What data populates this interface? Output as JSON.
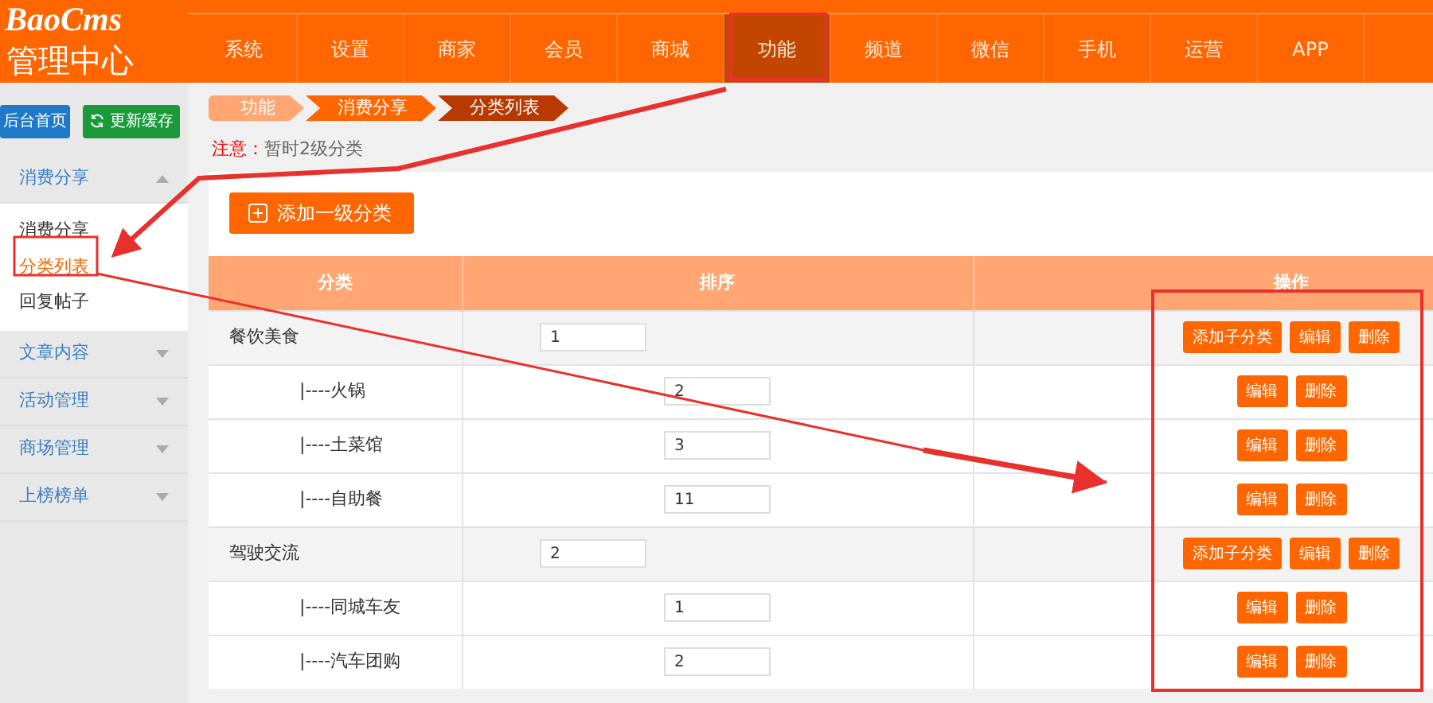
{
  "logo": {
    "brand": "BaoCms",
    "title": "管理中心"
  },
  "top_nav": [
    {
      "label": "系统",
      "selected": false
    },
    {
      "label": "设置",
      "selected": false
    },
    {
      "label": "商家",
      "selected": false
    },
    {
      "label": "会员",
      "selected": false
    },
    {
      "label": "商城",
      "selected": false
    },
    {
      "label": "功能",
      "selected": true
    },
    {
      "label": "频道",
      "selected": false
    },
    {
      "label": "微信",
      "selected": false
    },
    {
      "label": "手机",
      "selected": false
    },
    {
      "label": "运营",
      "selected": false
    },
    {
      "label": "APP",
      "selected": false
    }
  ],
  "sidebar": {
    "buttons": [
      {
        "label": "后台首页",
        "kind": "home"
      },
      {
        "label": "更新缓存",
        "kind": "refresh"
      }
    ],
    "groups": [
      {
        "label": "消费分享",
        "expanded": true,
        "items": [
          {
            "label": "消费分享",
            "selected": false
          },
          {
            "label": "分类列表",
            "selected": true
          },
          {
            "label": "回复帖子",
            "selected": false
          }
        ]
      },
      {
        "label": "文章内容",
        "expanded": false
      },
      {
        "label": "活动管理",
        "expanded": false
      },
      {
        "label": "商场管理",
        "expanded": false
      },
      {
        "label": "上榜榜单",
        "expanded": false
      }
    ]
  },
  "breadcrumb": [
    {
      "label": "功能"
    },
    {
      "label": "消费分享"
    },
    {
      "label": "分类列表"
    }
  ],
  "notice": {
    "label": "注意：",
    "text": "暂时2级分类"
  },
  "add_button": "添加一级分类",
  "table": {
    "columns": [
      "分类",
      "排序",
      "操作"
    ],
    "categories": [
      {
        "name": "餐饮美食",
        "sort": "1",
        "actions": [
          "添加子分类",
          "编辑",
          "删除"
        ],
        "children": [
          {
            "name": "|----火锅",
            "sort": "2",
            "actions": [
              "编辑",
              "删除"
            ]
          },
          {
            "name": "|----土菜馆",
            "sort": "3",
            "actions": [
              "编辑",
              "删除"
            ]
          },
          {
            "name": "|----自助餐",
            "sort": "11",
            "actions": [
              "编辑",
              "删除"
            ]
          }
        ]
      },
      {
        "name": "驾驶交流",
        "sort": "2",
        "actions": [
          "添加子分类",
          "编辑",
          "删除"
        ],
        "children": [
          {
            "name": "|----同城车友",
            "sort": "1",
            "actions": [
              "编辑",
              "删除"
            ]
          },
          {
            "name": "|----汽车团购",
            "sort": "2",
            "actions": [
              "编辑",
              "删除"
            ]
          }
        ]
      }
    ]
  }
}
